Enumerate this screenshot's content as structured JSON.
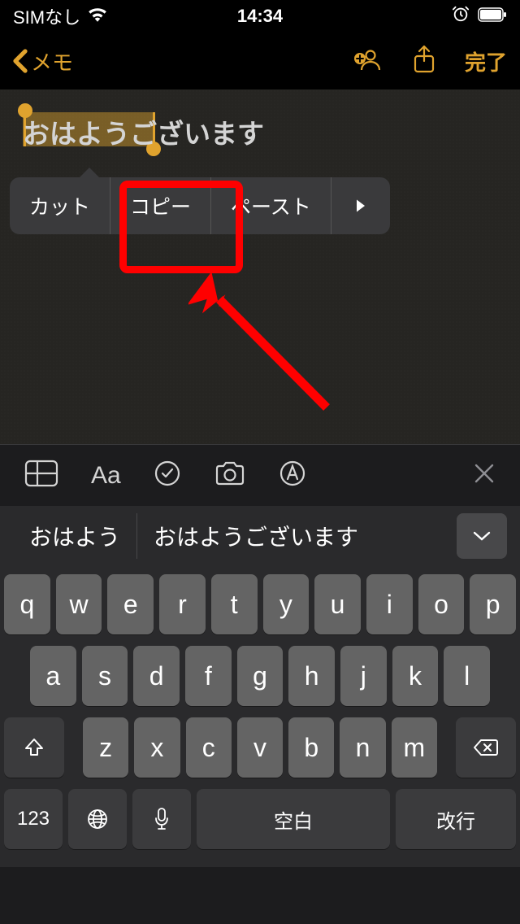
{
  "status_bar": {
    "carrier": "SIMなし",
    "time": "14:34"
  },
  "nav": {
    "back_label": "メモ",
    "done_label": "完了"
  },
  "note": {
    "text_full": "おはようございます",
    "selected": "おはよう"
  },
  "context_menu": {
    "cut": "カット",
    "copy": "コピー",
    "paste": "ペースト"
  },
  "suggestions": [
    "おはよう",
    "おはようございます"
  ],
  "keyboard": {
    "row1": [
      "q",
      "w",
      "e",
      "r",
      "t",
      "y",
      "u",
      "i",
      "o",
      "p"
    ],
    "row2": [
      "a",
      "s",
      "d",
      "f",
      "g",
      "h",
      "j",
      "k",
      "l"
    ],
    "row3": [
      "z",
      "x",
      "c",
      "v",
      "b",
      "n",
      "m"
    ],
    "numkey": "123",
    "space": "空白",
    "return": "改行"
  },
  "colors": {
    "accent": "#e0a32e",
    "highlight": "#ff0000"
  }
}
